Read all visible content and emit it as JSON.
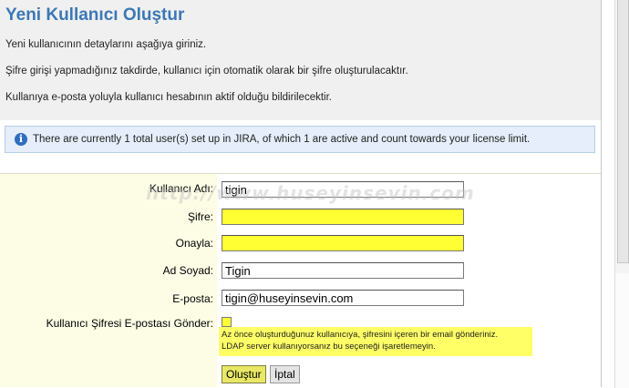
{
  "page": {
    "title": "Yeni Kullanıcı Oluştur",
    "desc1": "Yeni kullanıcının detaylarını aşağıya giriniz.",
    "desc2": "Şifre girişi yapmadığınız takdirde, kullanıcı için otomatik olarak bir şifre oluşturulacaktır.",
    "desc3": "Kullanıya e-posta yoluyla kullanıcı hesabının aktif olduğu bildirilecektir."
  },
  "info": {
    "text": "There are currently 1 total user(s) set up in JIRA, of which 1 are active and count towards your license limit."
  },
  "form": {
    "username_label": "Kullanıcı Adı:",
    "username_value": "tigin",
    "password_label": "Şifre:",
    "password_value": "",
    "confirm_label": "Onayla:",
    "confirm_value": "",
    "fullname_label": "Ad Soyad:",
    "fullname_value": "Tigin",
    "email_label": "E-posta:",
    "email_value": "tigin@huseyinsevin.com",
    "send_email_label": "Kullanıcı Şifresi E-postası Gönder:",
    "send_email_checked": false,
    "help_line1": "Az önce oluşturduğunuz kullanıcıya, şifresini içeren bir email gönderiniz.",
    "help_line2": "LDAP server kullanıyorsanız bu seçeneği işaretlemeyin."
  },
  "buttons": {
    "create": "Oluştur",
    "cancel": "İptal"
  },
  "watermark": "http://www.huseyinsevin.com",
  "colors": {
    "title": "#3c78b5",
    "highlight_yellow": "#ffff33",
    "info_bg": "#e5eefa"
  }
}
